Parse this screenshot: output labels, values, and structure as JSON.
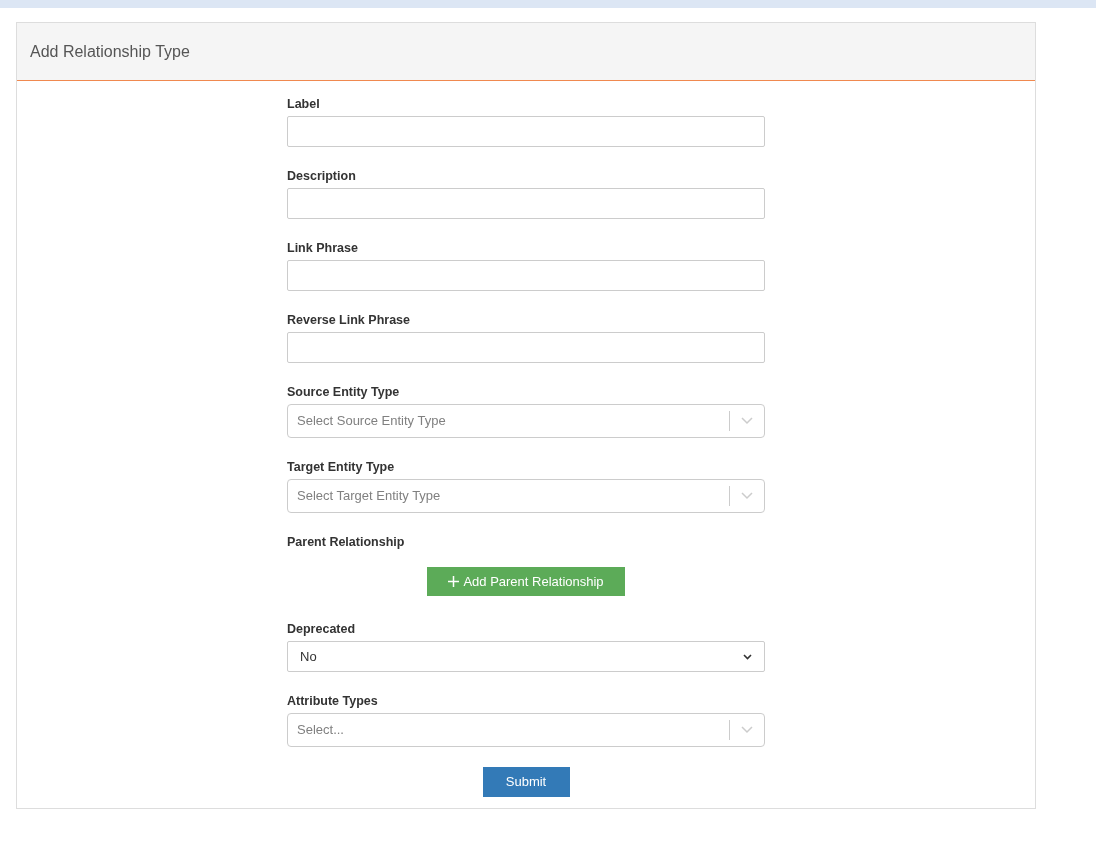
{
  "panel": {
    "title": "Add Relationship Type"
  },
  "fields": [
    {
      "kind": "text",
      "label": "Label"
    },
    {
      "kind": "text",
      "label": "Description"
    },
    {
      "kind": "text",
      "label": "Link Phrase"
    },
    {
      "kind": "text",
      "label": "Reverse Link Phrase"
    },
    {
      "kind": "combo",
      "label": "Source Entity Type",
      "placeholder": "Select Source Entity Type"
    },
    {
      "kind": "combo",
      "label": "Target Entity Type",
      "placeholder": "Select Target Entity Type"
    },
    {
      "kind": "button",
      "label": "Parent Relationship",
      "button": "Add Parent Relationship"
    },
    {
      "kind": "select",
      "label": "Deprecated",
      "value": "No"
    },
    {
      "kind": "combo",
      "label": "Attribute Types",
      "placeholder": "Select..."
    }
  ],
  "submit": "Submit"
}
